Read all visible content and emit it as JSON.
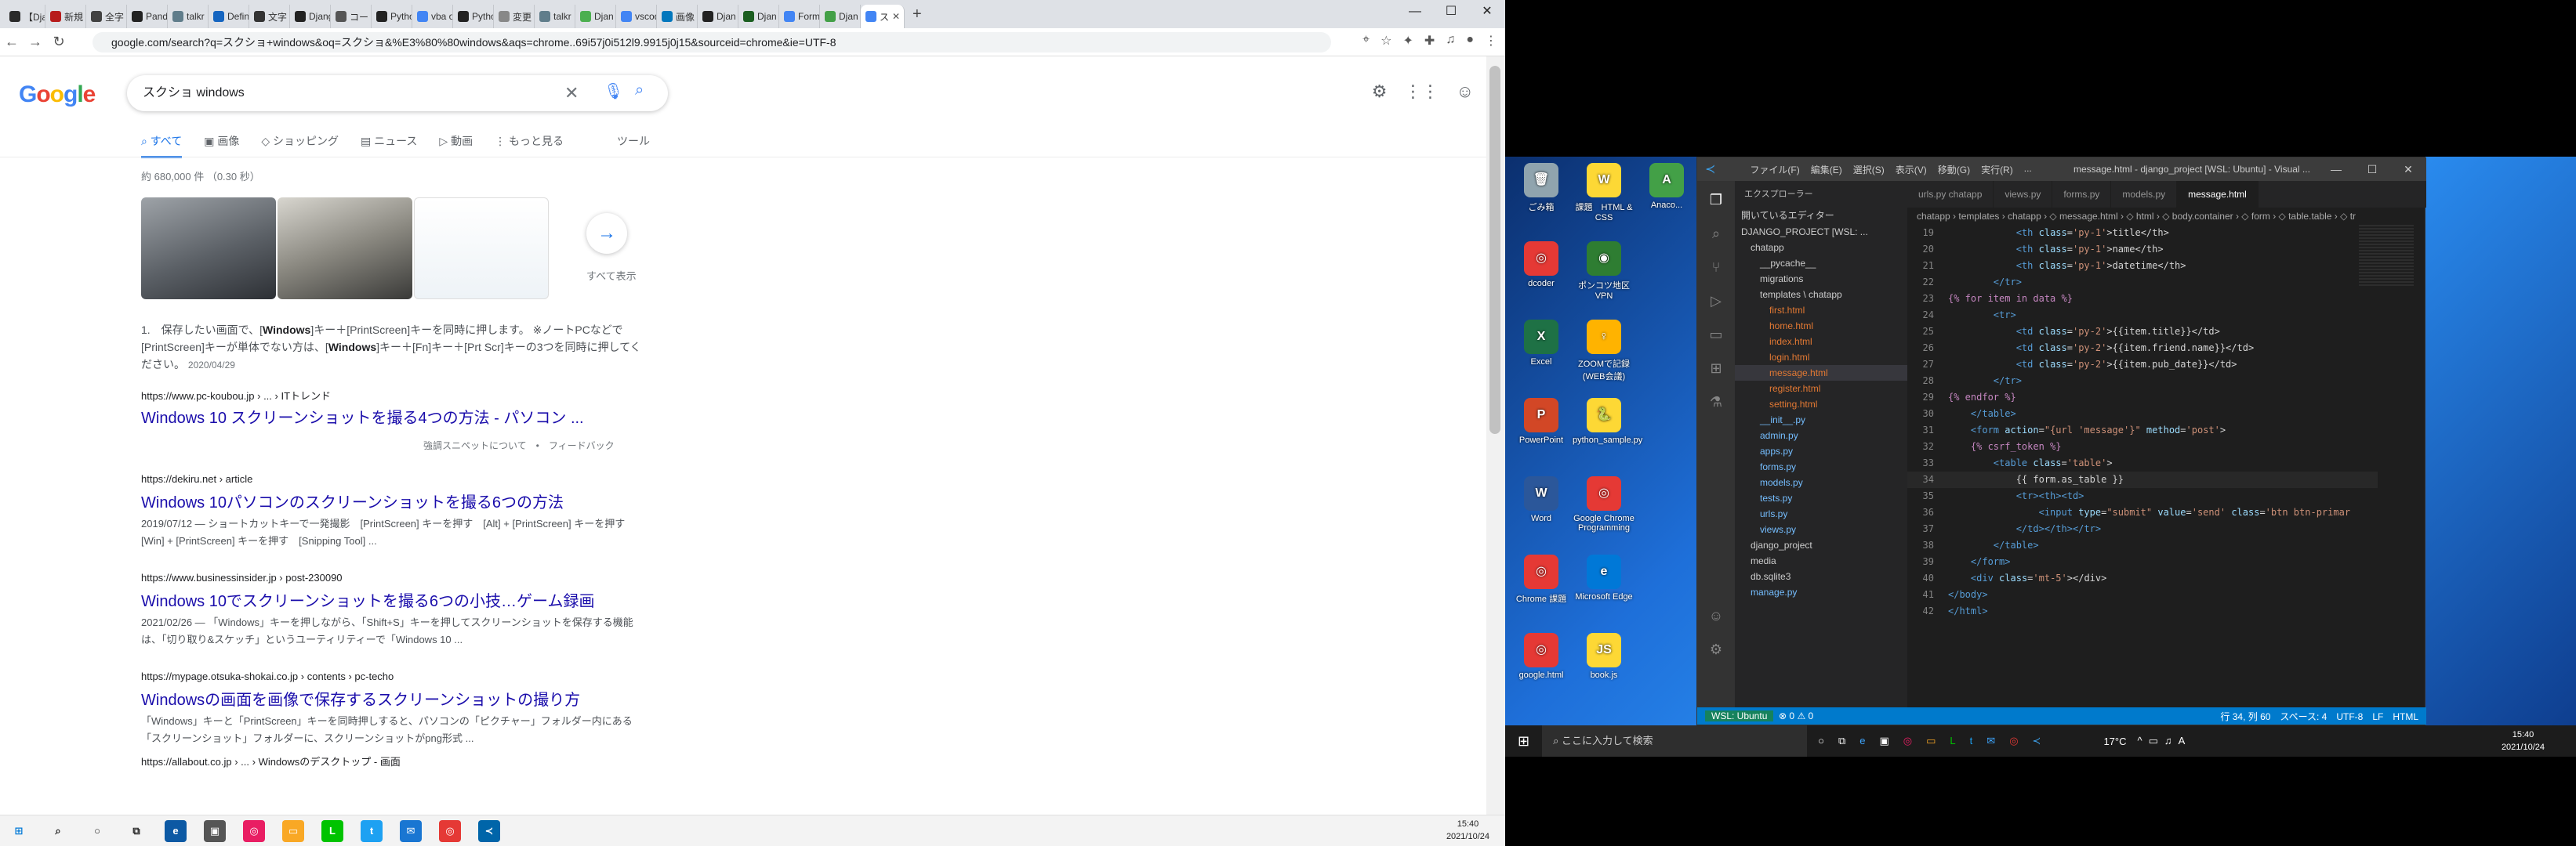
{
  "chrome": {
    "tabs": [
      {
        "label": "【Dja",
        "color": "#2a2a2a"
      },
      {
        "label": "新規",
        "color": "#b71c1c"
      },
      {
        "label": "全字",
        "color": "#424242"
      },
      {
        "label": "Pand",
        "color": "#222"
      },
      {
        "label": "talkr",
        "color": "#607d8b"
      },
      {
        "label": "Defin",
        "color": "#1565c0"
      },
      {
        "label": "文字",
        "color": "#333"
      },
      {
        "label": "Djang",
        "color": "#222"
      },
      {
        "label": "コード",
        "color": "#555"
      },
      {
        "label": "Pytho",
        "color": "#222"
      },
      {
        "label": "vba o",
        "color": "#4285f4"
      },
      {
        "label": "Pytho",
        "color": "#222"
      },
      {
        "label": "変更",
        "color": "#888"
      },
      {
        "label": "talkr",
        "color": "#607d8b"
      },
      {
        "label": "Djan",
        "color": "#4caf50"
      },
      {
        "label": "vscod",
        "color": "#4285f4"
      },
      {
        "label": "画像",
        "color": "#0277bd"
      },
      {
        "label": "Djan",
        "color": "#222"
      },
      {
        "label": "Djan",
        "color": "#1b5e20"
      },
      {
        "label": "Form",
        "color": "#4285f4"
      },
      {
        "label": "Djan",
        "color": "#43a047"
      },
      {
        "label": "ス",
        "color": "#4285f4",
        "active": true
      }
    ],
    "url": "google.com/search?q=スクショ+windows&oq=スクショ&%E3%80%80windows&aqs=chrome..69i57j0i512l9.9915j0j15&sourceid=chrome&ie=UTF-8"
  },
  "google": {
    "logo": "Google",
    "query": "スクショ windows",
    "tabs": [
      "すべて",
      "画像",
      "ショッピング",
      "ニュース",
      "動画",
      "もっと見る",
      "ツール"
    ],
    "stats": "約 680,000 件 （0.30 秒）",
    "see_all": "すべて表示",
    "featured": {
      "text_parts": [
        "1.　保存したい画面で、[",
        "Windows",
        "]キー＋[PrintScreen]キーを同時に押します。 ※ノートPCなどで[PrintScreen]キーが単体でない方は、[",
        "Windows",
        "]キー＋[Fn]キー＋[Prt Scr]キーの3つを同時に押してください。"
      ],
      "date": "2020/04/29",
      "url": "https://www.pc-koubou.jp › ... › ITトレンド",
      "title": "Windows 10 スクリーンショットを撮る4つの方法 - パソコン ...",
      "about": "強調スニペットについて　•　フィードバック"
    },
    "results": [
      {
        "url": "https://dekiru.net › article",
        "title": "Windows 10パソコンのスクリーンショットを撮る6つの方法",
        "desc": "2019/07/12 — ショートカットキーで一発撮影　[PrintScreen] キーを押す　[Alt] + [PrintScreen] キーを押す　[Win] + [PrintScreen] キーを押す　[Snipping Tool] ..."
      },
      {
        "url": "https://www.businessinsider.jp › post-230090",
        "title": "Windows 10でスクリーンショットを撮る6つの小技…ゲーム録画",
        "desc": "2021/02/26 — 「Windows」キーを押しながら、「Shift+S」キーを押してスクリーンショットを保存する機能は、「切り取り&スケッチ」というユーティリティーで「Windows 10 ..."
      },
      {
        "url": "https://mypage.otsuka-shokai.co.jp › contents › pc-techo",
        "title": "Windowsの画面を画像で保存するスクリーンショットの撮り方",
        "desc": "「Windows」キーと「PrintScreen」キーを同時押しすると、パソコンの「ピクチャー」フォルダー内にある「スクリーンショット」フォルダーに、スクリーンショットがpng形式 ..."
      },
      {
        "url": "https://allabout.co.jp › ... › Windowsのデスクトップ - 画面",
        "title": "",
        "desc": ""
      }
    ]
  },
  "left_taskbar": {
    "clock_time": "15:40",
    "clock_date": "2021/10/24"
  },
  "desktop_icons": [
    {
      "label": "ごみ箱",
      "color": "#90a4ae",
      "glyph": "🗑"
    },
    {
      "label": "課題　HTML & CSS",
      "color": "#fdd835",
      "glyph": "W"
    },
    {
      "label": "Anaco...",
      "color": "#43a047",
      "glyph": "A"
    },
    {
      "label": "dcoder",
      "color": "#e53935",
      "glyph": "◎"
    },
    {
      "label": "ポンコツ地区 VPN",
      "color": "#2e7d32",
      "glyph": "◉"
    },
    {
      "label": "Excel",
      "color": "#1e7145",
      "glyph": "X"
    },
    {
      "label": "ZOOMで記録 (WEB会議)",
      "color": "#ffb300",
      "glyph": "♀"
    },
    {
      "label": "PowerPoint",
      "color": "#d24726",
      "glyph": "P"
    },
    {
      "label": "python_sample.py",
      "color": "#fdd835",
      "glyph": "🐍"
    },
    {
      "label": "Word",
      "color": "#2b579a",
      "glyph": "W"
    },
    {
      "label": "Google Chrome Programming",
      "color": "#e53935",
      "glyph": "◎"
    },
    {
      "label": "Chrome 課題",
      "color": "#e53935",
      "glyph": "◎"
    },
    {
      "label": "Microsoft Edge",
      "color": "#0078d7",
      "glyph": "e"
    },
    {
      "label": "google.html",
      "color": "#e53935",
      "glyph": "◎"
    },
    {
      "label": "book.js",
      "color": "#fdd835",
      "glyph": "JS"
    }
  ],
  "vscode": {
    "menu": [
      "ファイル(F)",
      "編集(E)",
      "選択(S)",
      "表示(V)",
      "移動(G)",
      "実行(R)",
      "..."
    ],
    "title": "message.html - django_project [WSL: Ubuntu] - Visual ...",
    "explorer_title": "エクスプローラー",
    "tree": [
      {
        "name": "開いているエディター",
        "cls": "",
        "indent": 8
      },
      {
        "name": "DJANGO_PROJECT [WSL: ...",
        "cls": "",
        "indent": 8
      },
      {
        "name": "chatapp",
        "cls": "",
        "indent": 20
      },
      {
        "name": "__pycache__",
        "cls": "",
        "indent": 32
      },
      {
        "name": "migrations",
        "cls": "",
        "indent": 32
      },
      {
        "name": "templates \\ chatapp",
        "cls": "",
        "indent": 32
      },
      {
        "name": "first.html",
        "cls": "html",
        "indent": 44
      },
      {
        "name": "home.html",
        "cls": "html",
        "indent": 44
      },
      {
        "name": "index.html",
        "cls": "html",
        "indent": 44
      },
      {
        "name": "login.html",
        "cls": "html",
        "indent": 44
      },
      {
        "name": "message.html",
        "cls": "html",
        "indent": 44
      },
      {
        "name": "register.html",
        "cls": "html",
        "indent": 44
      },
      {
        "name": "setting.html",
        "cls": "html",
        "indent": 44
      },
      {
        "name": "__init__.py",
        "cls": "py",
        "indent": 32
      },
      {
        "name": "admin.py",
        "cls": "py",
        "indent": 32
      },
      {
        "name": "apps.py",
        "cls": "py",
        "indent": 32
      },
      {
        "name": "forms.py",
        "cls": "py",
        "indent": 32
      },
      {
        "name": "models.py",
        "cls": "py",
        "indent": 32
      },
      {
        "name": "tests.py",
        "cls": "py",
        "indent": 32
      },
      {
        "name": "urls.py",
        "cls": "py",
        "indent": 32
      },
      {
        "name": "views.py",
        "cls": "py",
        "indent": 32
      },
      {
        "name": "django_project",
        "cls": "",
        "indent": 20
      },
      {
        "name": "media",
        "cls": "",
        "indent": 20
      },
      {
        "name": "db.sqlite3",
        "cls": "",
        "indent": 20
      },
      {
        "name": "manage.py",
        "cls": "py",
        "indent": 20
      }
    ],
    "tabs": [
      "urls.py chatapp",
      "views.py",
      "forms.py",
      "models.py",
      "message.html"
    ],
    "breadcrumb": "chatapp › templates › chatapp › ◇ message.html › ◇ html › ◇ body.container › ◇ form › ◇ table.table › ◇ tr",
    "code": [
      {
        "n": "19",
        "html": "&nbsp;&nbsp;&nbsp;&nbsp;&nbsp;&nbsp;&nbsp;&nbsp;&nbsp;&nbsp;&nbsp;&nbsp;<span class='tg'>&lt;th</span> <span class='at'>class</span>=<span class='st'>'py-1'</span>&gt;title&lt;/th&gt;"
      },
      {
        "n": "20",
        "html": "&nbsp;&nbsp;&nbsp;&nbsp;&nbsp;&nbsp;&nbsp;&nbsp;&nbsp;&nbsp;&nbsp;&nbsp;<span class='tg'>&lt;th</span> <span class='at'>class</span>=<span class='st'>'py-1'</span>&gt;name&lt;/th&gt;"
      },
      {
        "n": "21",
        "html": "&nbsp;&nbsp;&nbsp;&nbsp;&nbsp;&nbsp;&nbsp;&nbsp;&nbsp;&nbsp;&nbsp;&nbsp;<span class='tg'>&lt;th</span> <span class='at'>class</span>=<span class='st'>'py-1'</span>&gt;datetime&lt;/th&gt;"
      },
      {
        "n": "22",
        "html": "&nbsp;&nbsp;&nbsp;&nbsp;&nbsp;&nbsp;&nbsp;&nbsp;<span class='tg'>&lt;/tr&gt;</span>"
      },
      {
        "n": "23",
        "html": "<span class='tp'>{% for item in data %}</span>"
      },
      {
        "n": "24",
        "html": "&nbsp;&nbsp;&nbsp;&nbsp;&nbsp;&nbsp;&nbsp;&nbsp;<span class='tg'>&lt;tr&gt;</span>"
      },
      {
        "n": "25",
        "html": "&nbsp;&nbsp;&nbsp;&nbsp;&nbsp;&nbsp;&nbsp;&nbsp;&nbsp;&nbsp;&nbsp;&nbsp;<span class='tg'>&lt;td</span> <span class='at'>class</span>=<span class='st'>'py-2'</span>&gt;{{item.title}}&lt;/td&gt;"
      },
      {
        "n": "26",
        "html": "&nbsp;&nbsp;&nbsp;&nbsp;&nbsp;&nbsp;&nbsp;&nbsp;&nbsp;&nbsp;&nbsp;&nbsp;<span class='tg'>&lt;td</span> <span class='at'>class</span>=<span class='st'>'py-2'</span>&gt;{{item.friend.name}}&lt;/td&gt;"
      },
      {
        "n": "27",
        "html": "&nbsp;&nbsp;&nbsp;&nbsp;&nbsp;&nbsp;&nbsp;&nbsp;&nbsp;&nbsp;&nbsp;&nbsp;<span class='tg'>&lt;td</span> <span class='at'>class</span>=<span class='st'>'py-2'</span>&gt;{{item.pub_date}}&lt;/td&gt;"
      },
      {
        "n": "28",
        "html": "&nbsp;&nbsp;&nbsp;&nbsp;&nbsp;&nbsp;&nbsp;&nbsp;<span class='tg'>&lt;/tr&gt;</span>"
      },
      {
        "n": "29",
        "html": "<span class='tp'>{% endfor %}</span>"
      },
      {
        "n": "30",
        "html": "&nbsp;&nbsp;&nbsp;&nbsp;<span class='tg'>&lt;/table&gt;</span>"
      },
      {
        "n": "31",
        "html": "&nbsp;&nbsp;&nbsp;&nbsp;<span class='tg'>&lt;form</span> <span class='at'>action</span>=<span class='st'>\"{url 'message'}\"</span> <span class='at'>method</span>=<span class='st'>'post'</span>&gt;"
      },
      {
        "n": "32",
        "html": "&nbsp;&nbsp;&nbsp;&nbsp;<span class='tp'>{% csrf_token %}</span>"
      },
      {
        "n": "33",
        "html": "&nbsp;&nbsp;&nbsp;&nbsp;&nbsp;&nbsp;&nbsp;&nbsp;<span class='tg'>&lt;table</span> <span class='at'>class</span>=<span class='st'>'table'</span>&gt;"
      },
      {
        "n": "34",
        "html": "&nbsp;&nbsp;&nbsp;&nbsp;&nbsp;&nbsp;&nbsp;&nbsp;&nbsp;&nbsp;&nbsp;&nbsp;{{ form.as_table }}"
      },
      {
        "n": "35",
        "html": "&nbsp;&nbsp;&nbsp;&nbsp;&nbsp;&nbsp;&nbsp;&nbsp;&nbsp;&nbsp;&nbsp;&nbsp;<span class='tg'>&lt;tr&gt;&lt;th&gt;&lt;td&gt;</span>"
      },
      {
        "n": "36",
        "html": "&nbsp;&nbsp;&nbsp;&nbsp;&nbsp;&nbsp;&nbsp;&nbsp;&nbsp;&nbsp;&nbsp;&nbsp;&nbsp;&nbsp;&nbsp;&nbsp;<span class='tg'>&lt;input</span> <span class='at'>type</span>=<span class='st'>\"submit\"</span> <span class='at'>value</span>=<span class='st'>'send'</span> <span class='at'>class</span>=<span class='st'>'btn btn-primar</span>"
      },
      {
        "n": "37",
        "html": "&nbsp;&nbsp;&nbsp;&nbsp;&nbsp;&nbsp;&nbsp;&nbsp;&nbsp;&nbsp;&nbsp;&nbsp;<span class='tg'>&lt;/td&gt;&lt;/th&gt;&lt;/tr&gt;</span>"
      },
      {
        "n": "38",
        "html": "&nbsp;&nbsp;&nbsp;&nbsp;&nbsp;&nbsp;&nbsp;&nbsp;<span class='tg'>&lt;/table&gt;</span>"
      },
      {
        "n": "39",
        "html": "&nbsp;&nbsp;&nbsp;&nbsp;<span class='tg'>&lt;/form&gt;</span>"
      },
      {
        "n": "40",
        "html": "&nbsp;&nbsp;&nbsp;&nbsp;<span class='tg'>&lt;div</span> <span class='at'>class</span>=<span class='st'>'mt-5'</span>&gt;&lt;/div&gt;"
      },
      {
        "n": "41",
        "html": "<span class='tg'>&lt;/body&gt;</span>"
      },
      {
        "n": "42",
        "html": "<span class='tg'>&lt;/html&gt;</span>"
      }
    ],
    "status_left": "WSL: Ubuntu",
    "status_errors": "⊗ 0 ⚠ 0",
    "status_right": "行 34, 列 60　スペース: 4　UTF-8　LF　HTML"
  },
  "right_taskbar": {
    "search_placeholder": "ここに入力して検索",
    "temp": "17°C",
    "clock_time": "15:40",
    "clock_date": "2021/10/24"
  }
}
